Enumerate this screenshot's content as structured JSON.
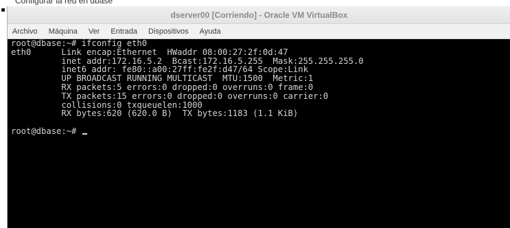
{
  "caption": "Configurar la red en dbase",
  "window": {
    "title": "dserver00 [Corriendo] - Oracle VM VirtualBox",
    "menu": [
      "Archivo",
      "Máquina",
      "Ver",
      "Entrada",
      "Dispositivos",
      "Ayuda"
    ]
  },
  "terminal": {
    "lines": [
      "root@dbase:~# ifconfig eth0",
      "eth0      Link encap:Ethernet  HWaddr 08:00:27:2f:0d:47",
      "          inet addr:172.16.5.2  Bcast:172.16.5.255  Mask:255.255.255.0",
      "          inet6 addr: fe80::a00:27ff:fe2f:d47/64 Scope:Link",
      "          UP BROADCAST RUNNING MULTICAST  MTU:1500  Metric:1",
      "          RX packets:5 errors:0 dropped:0 overruns:0 frame:0",
      "          TX packets:15 errors:0 dropped:0 overruns:0 carrier:0",
      "          collisions:0 txqueuelen:1000",
      "          RX bytes:620 (620.0 B)  TX bytes:1183 (1.1 KiB)",
      "",
      "root@dbase:~# "
    ]
  }
}
